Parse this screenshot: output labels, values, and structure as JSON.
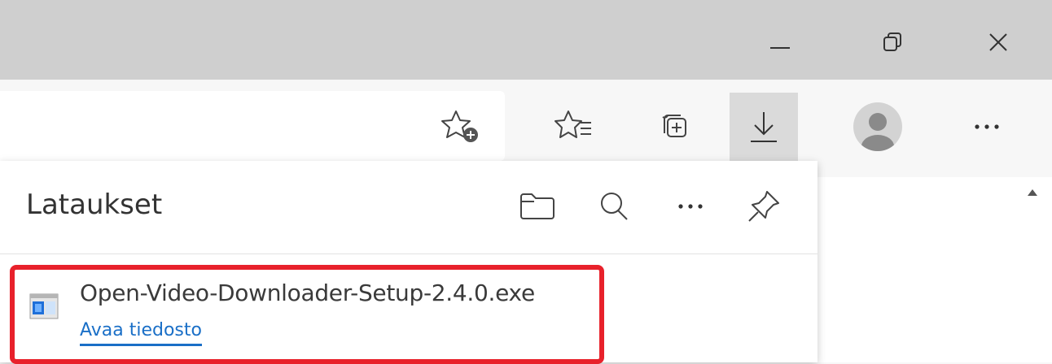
{
  "window": {
    "controls": [
      {
        "name": "minimize-button",
        "icon": "minimize-icon"
      },
      {
        "name": "restore-button",
        "icon": "restore-icon"
      },
      {
        "name": "close-button",
        "icon": "close-icon"
      }
    ]
  },
  "toolbar": {
    "buttons": [
      {
        "name": "add-favorite-button",
        "icon": "star-add-icon"
      },
      {
        "name": "favorites-button",
        "icon": "favorites-list-icon"
      },
      {
        "name": "collections-button",
        "icon": "collections-icon"
      },
      {
        "name": "downloads-button",
        "icon": "download-icon",
        "active": true
      },
      {
        "name": "profile-button",
        "icon": "avatar-icon"
      },
      {
        "name": "settings-more-button",
        "icon": "ellipsis-icon"
      }
    ]
  },
  "downloads_panel": {
    "title": "Lataukset",
    "header_buttons": [
      {
        "name": "open-folder-button",
        "icon": "folder-icon"
      },
      {
        "name": "search-downloads-button",
        "icon": "search-icon"
      },
      {
        "name": "more-options-button",
        "icon": "ellipsis-icon"
      },
      {
        "name": "pin-panel-button",
        "icon": "pin-icon"
      }
    ],
    "items": [
      {
        "file_name": "Open-Video-Downloader-Setup-2.4.0.exe",
        "action_label": "Avaa tiedosto",
        "icon": "installer-file-icon"
      }
    ]
  },
  "colors": {
    "highlight": "#e8212b",
    "link": "#1a6fc7",
    "titlebar": "#cfcfcf"
  }
}
